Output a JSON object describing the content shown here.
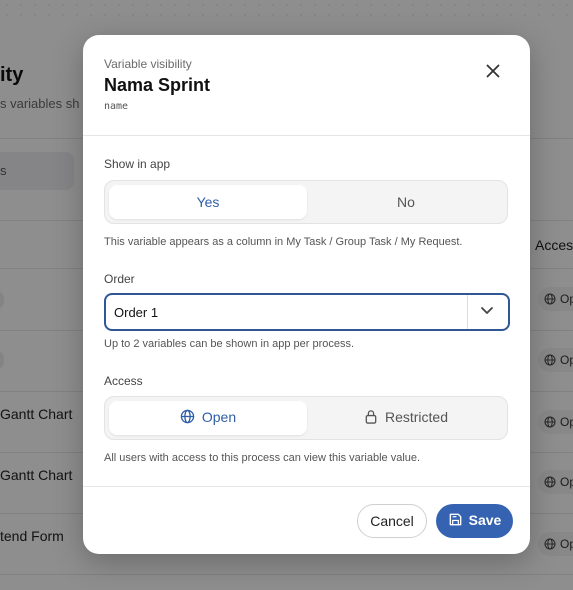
{
  "background": {
    "title": "ity",
    "subtitle": "s variables sh",
    "tab_label": "s",
    "access_header": "Acces",
    "rows": [
      {
        "label": ""
      },
      {
        "label": ""
      },
      {
        "label": "Gantt Chart"
      },
      {
        "label": "Gantt Chart"
      },
      {
        "label": "tend Form"
      }
    ],
    "open_chip_label": "Op"
  },
  "modal": {
    "eyebrow": "Variable visibility",
    "title": "Nama Sprint",
    "code": "name",
    "close_icon": "close-icon",
    "show_in_app": {
      "label": "Show in app",
      "options": [
        "Yes",
        "No"
      ],
      "selected": "Yes",
      "help": "This variable appears as a column in My Task / Group Task / My Request."
    },
    "order": {
      "label": "Order",
      "value": "Order 1",
      "help": "Up to 2 variables can be shown in app per process."
    },
    "access": {
      "label": "Access",
      "options": [
        {
          "label": "Open",
          "icon": "globe-icon"
        },
        {
          "label": "Restricted",
          "icon": "lock-icon"
        }
      ],
      "selected": "Open",
      "help": "All users with access to this process can view this variable value."
    },
    "footer": {
      "cancel_label": "Cancel",
      "save_label": "Save",
      "save_icon": "save-icon"
    }
  },
  "colors": {
    "accent": "#3563b1",
    "focus_border": "#2f5795",
    "active_text": "#2f5fa7"
  }
}
